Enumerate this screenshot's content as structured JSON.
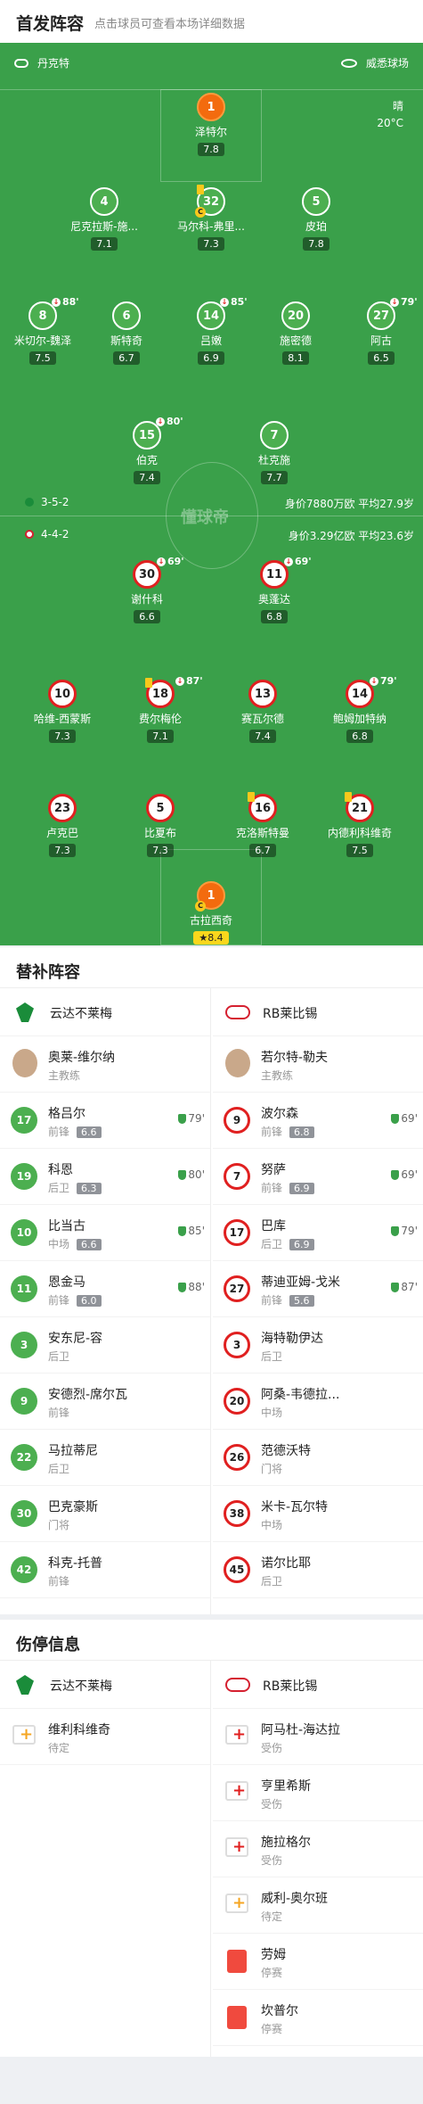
{
  "header": {
    "title": "首发阵容",
    "subtitle": "点击球员可查看本场详细数据"
  },
  "pitch": {
    "home_team": "丹克特",
    "venue": "威悉球场",
    "weather": "晴",
    "temperature": "20°C",
    "watermark": "懂球帝",
    "home_formation": "3-5-2",
    "home_value": "身价7880万欧 平均27.9岁",
    "away_formation": "4-4-2",
    "away_value": "身价3.29亿欧 平均23.6岁"
  },
  "home_players": [
    {
      "num": "1",
      "name": "泽特尔",
      "rating": "7.8"
    },
    {
      "num": "4",
      "name": "尼克拉斯-施...",
      "rating": "7.1"
    },
    {
      "num": "32",
      "name": "马尔科-弗里...",
      "rating": "7.3"
    },
    {
      "num": "5",
      "name": "皮珀",
      "rating": "7.8"
    },
    {
      "num": "8",
      "name": "米切尔-魏泽",
      "rating": "7.5",
      "sub": "88'"
    },
    {
      "num": "6",
      "name": "斯特奇",
      "rating": "6.7"
    },
    {
      "num": "14",
      "name": "吕嫩",
      "rating": "6.9",
      "sub": "85'"
    },
    {
      "num": "20",
      "name": "施密德",
      "rating": "8.1"
    },
    {
      "num": "27",
      "name": "阿古",
      "rating": "6.5",
      "sub": "79'"
    },
    {
      "num": "15",
      "name": "伯克",
      "rating": "7.4",
      "sub": "80'"
    },
    {
      "num": "7",
      "name": "杜克施",
      "rating": "7.7"
    }
  ],
  "away_players": [
    {
      "num": "30",
      "name": "谢什科",
      "rating": "6.6",
      "sub": "69'"
    },
    {
      "num": "11",
      "name": "奥蓬达",
      "rating": "6.8",
      "sub": "69'"
    },
    {
      "num": "10",
      "name": "哈维-西蒙斯",
      "rating": "7.3"
    },
    {
      "num": "18",
      "name": "费尔梅伦",
      "rating": "7.1",
      "sub": "87'"
    },
    {
      "num": "13",
      "name": "赛瓦尔德",
      "rating": "7.4"
    },
    {
      "num": "14",
      "name": "鲍姆加特纳",
      "rating": "6.8",
      "sub": "79'"
    },
    {
      "num": "23",
      "name": "卢克巴",
      "rating": "7.3"
    },
    {
      "num": "5",
      "name": "比夏布",
      "rating": "7.3"
    },
    {
      "num": "16",
      "name": "克洛斯特曼",
      "rating": "6.7"
    },
    {
      "num": "21",
      "name": "内德利科维奇",
      "rating": "7.5"
    },
    {
      "num": "1",
      "name": "古拉西奇",
      "rating": "8.4"
    }
  ],
  "subs": {
    "title": "替补阵容",
    "home_team": "云达不莱梅",
    "away_team": "RB莱比锡",
    "home_coach": {
      "name": "奥莱-维尔纳",
      "role": "主教练"
    },
    "away_coach": {
      "name": "若尔特-勒夫",
      "role": "主教练"
    },
    "home": [
      {
        "num": "17",
        "name": "格吕尔",
        "pos": "前锋",
        "rating": "6.6",
        "min": "79'"
      },
      {
        "num": "19",
        "name": "科恩",
        "pos": "后卫",
        "rating": "6.3",
        "min": "80'"
      },
      {
        "num": "10",
        "name": "比当古",
        "pos": "中场",
        "rating": "6.6",
        "min": "85'"
      },
      {
        "num": "11",
        "name": "恩金马",
        "pos": "前锋",
        "rating": "6.0",
        "min": "88'"
      },
      {
        "num": "3",
        "name": "安东尼-容",
        "pos": "后卫"
      },
      {
        "num": "9",
        "name": "安德烈-席尔瓦",
        "pos": "前锋"
      },
      {
        "num": "22",
        "name": "马拉蒂尼",
        "pos": "后卫"
      },
      {
        "num": "30",
        "name": "巴克豪斯",
        "pos": "门将"
      },
      {
        "num": "42",
        "name": "科克-托普",
        "pos": "前锋"
      }
    ],
    "away": [
      {
        "num": "9",
        "name": "波尔森",
        "pos": "前锋",
        "rating": "6.8",
        "min": "69'"
      },
      {
        "num": "7",
        "name": "努萨",
        "pos": "前锋",
        "rating": "6.9",
        "min": "69'"
      },
      {
        "num": "17",
        "name": "巴库",
        "pos": "后卫",
        "rating": "6.9",
        "min": "79'"
      },
      {
        "num": "27",
        "name": "蒂迪亚姆-戈米",
        "pos": "前锋",
        "rating": "5.6",
        "min": "87'"
      },
      {
        "num": "3",
        "name": "海特勒伊达",
        "pos": "后卫"
      },
      {
        "num": "20",
        "name": "阿桑-韦德拉...",
        "pos": "中场"
      },
      {
        "num": "26",
        "name": "范德沃特",
        "pos": "门将"
      },
      {
        "num": "38",
        "name": "米卡-瓦尔特",
        "pos": "中场"
      },
      {
        "num": "45",
        "name": "诺尔比耶",
        "pos": "后卫"
      }
    ]
  },
  "injuries": {
    "title": "伤停信息",
    "home_team": "云达不莱梅",
    "away_team": "RB莱比锡",
    "home": [
      {
        "name": "维利科维奇",
        "status": "待定"
      }
    ],
    "away": [
      {
        "name": "阿马杜-海达拉",
        "status": "受伤"
      },
      {
        "name": "亨里希斯",
        "status": "受伤"
      },
      {
        "name": "施拉格尔",
        "status": "受伤"
      },
      {
        "name": "威利-奥尔班",
        "status": "待定"
      },
      {
        "name": "劳姆",
        "status": "停赛"
      },
      {
        "name": "坎普尔",
        "status": "停赛"
      }
    ]
  }
}
